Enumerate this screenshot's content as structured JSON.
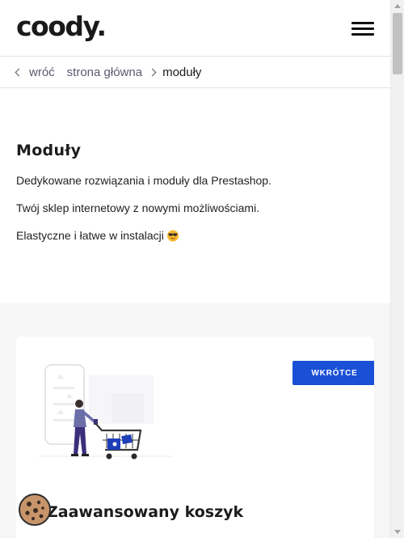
{
  "header": {
    "logo": "coody.",
    "menu_icon": "hamburger-menu-icon"
  },
  "breadcrumb": {
    "back_label": "wróć",
    "home_label": "strona główna",
    "current_label": "moduły",
    "back_icon": "chevron-left-icon",
    "separator_icon": "chevron-right-icon"
  },
  "intro": {
    "title": "Moduły",
    "paragraphs": [
      "Dedykowane rozwiązania i moduły dla Prestashop.",
      "Twój sklep internetowy z nowymi możliwościami.",
      "Elastyczne i łatwe w instalacji"
    ],
    "emoji_icon": "sunglasses-emoji-icon"
  },
  "card": {
    "badge": "WKRÓTCE",
    "title": "Zaawansowany koszyk",
    "illustration_icon": "shopping-cart-illustration-icon"
  },
  "cookie": {
    "icon": "cookie-icon"
  },
  "colors": {
    "accent": "#1a50d6",
    "section_bg": "#f6f6f6",
    "text": "#1c1c1c",
    "muted": "#5a5a6e",
    "illustration_purple": "#3b2f7a"
  }
}
